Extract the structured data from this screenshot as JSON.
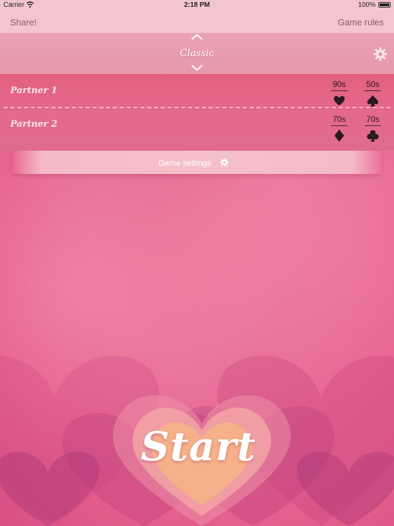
{
  "status_bar": {
    "carrier": "Carrier",
    "time": "2:18 PM",
    "battery": "100%"
  },
  "nav": {
    "share_label": "Share!",
    "rules_label": "Game rules"
  },
  "mode": {
    "label": "Classic"
  },
  "teams": [
    {
      "name": "Partner 1",
      "scores": [
        {
          "value": "90s",
          "suit": "heart-icon"
        },
        {
          "value": "50s",
          "suit": "spade-icon"
        }
      ]
    },
    {
      "name": "Partner 2",
      "scores": [
        {
          "value": "70s",
          "suit": "diamond-icon"
        },
        {
          "value": "70s",
          "suit": "club-icon"
        }
      ]
    }
  ],
  "settings": {
    "label": "Game settings"
  },
  "start": {
    "label": "Start"
  },
  "colors": {
    "background": "#e35d8c",
    "bar": "#f2c5d1",
    "heart_core": "#f6b08a"
  }
}
